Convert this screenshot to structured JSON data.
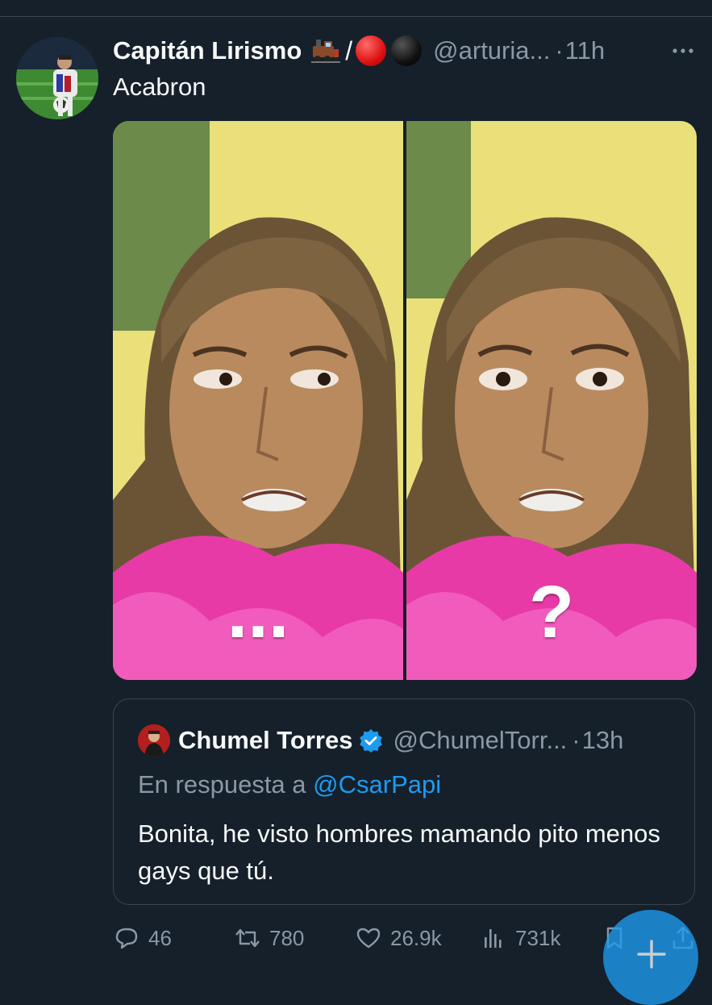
{
  "tweet": {
    "display_name": "Capitán Lirismo",
    "name_separator": "/",
    "handle": "@arturia...",
    "separator": "·",
    "time": "11h",
    "text": "Acabron"
  },
  "media": {
    "left_caption": "...",
    "right_caption": "?"
  },
  "quote": {
    "display_name": "Chumel Torres",
    "handle": "@ChumelTorr...",
    "separator": "·",
    "time": "13h",
    "reply_prefix": "En respuesta a",
    "reply_mention": "@CsarPapi",
    "text": "Bonita, he visto hombres mamando pito menos gays que tú."
  },
  "actions": {
    "replies": "46",
    "retweets": "780",
    "likes": "26.9k",
    "views": "731k"
  },
  "icons": {
    "more": "more-horizontal-icon",
    "verified": "verified-badge-icon",
    "reply": "comment-bubble-icon",
    "retweet": "retweet-arrows-icon",
    "like": "heart-icon",
    "views": "bar-chart-icon",
    "bookmark": "bookmark-icon",
    "share": "share-upload-icon",
    "compose": "plus-icon"
  },
  "colors": {
    "background": "#15202b",
    "text": "#f7f9f9",
    "muted": "#8b98a5",
    "accent": "#1d9bf0",
    "border": "#38444d"
  }
}
